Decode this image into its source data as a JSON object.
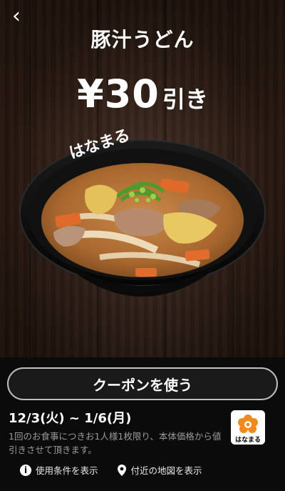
{
  "header": {
    "back_icon": "chevron-left-icon",
    "back_glyph": "‹"
  },
  "coupon": {
    "title": "豚汁うどん",
    "discount_amount": "¥30",
    "discount_suffix": "引き",
    "button_label": "クーポンを使う",
    "valid_period": "12/3(火) ~ 1/6(月)",
    "terms": "1回のお食事につきお1人様1枚限り、本体価格から値引きさせて頂きます。",
    "store_logo_text": "はなまる",
    "bowl_brand_text": "はなまる"
  },
  "links": {
    "terms_label": "使用条件を表示",
    "terms_icon": "info-icon",
    "terms_glyph": "i",
    "map_label": "付近の地図を表示",
    "map_icon": "map-pin-icon"
  },
  "colors": {
    "panel_bg": "#0b0b0b",
    "button_border": "#bfbfbf",
    "text_white": "#ffffff",
    "text_gray": "#9a9a9a"
  }
}
